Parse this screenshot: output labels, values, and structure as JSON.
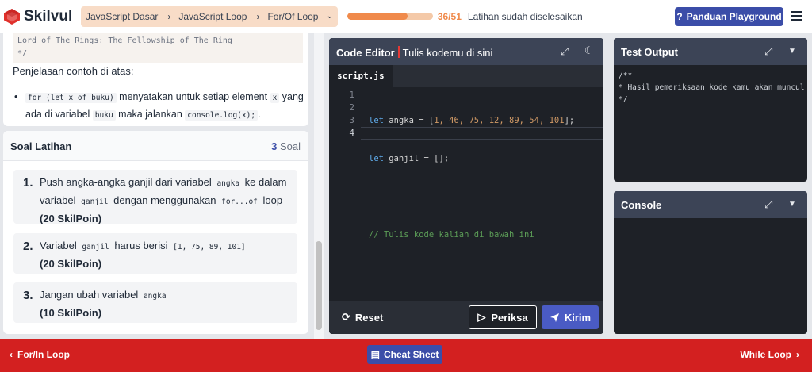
{
  "brand": {
    "name": "Skilvul",
    "color": "#e0302b"
  },
  "breadcrumb": {
    "items": [
      "JavaScript Dasar",
      "JavaScript Loop",
      "For/Of Loop"
    ]
  },
  "progress": {
    "fraction": 0.706,
    "count": "36/51",
    "label": "Latihan sudah diselesaikan",
    "color": "#f08a4b"
  },
  "header": {
    "guide_button": "Panduan Playground"
  },
  "lesson": {
    "code_line1": "Lord of The Rings: The Fellowship of The Ring",
    "code_line2": "*/",
    "explain_heading": "Penjelasan contoh di atas:",
    "bullet": {
      "code_for": "for (let x of buku)",
      "t1": "menyatakan untuk setiap element",
      "code_x": "x",
      "t2": "yang ada di variabel",
      "code_buku": "buku",
      "t3": "maka jalankan",
      "code_log": "console.log(x);",
      "t4": "."
    }
  },
  "exercises": {
    "title": "Soal Latihan",
    "count_number": "3",
    "count_label": "Soal",
    "items": [
      {
        "num": "1.",
        "t1": "Push angka-angka ganjil dari variabel",
        "c1": "angka",
        "t2": "ke dalam variabel",
        "c2": "ganjil",
        "t3": "dengan menggunakan",
        "c3": "for...of",
        "t4": "loop",
        "points": "(20 SkilPoin)"
      },
      {
        "num": "2.",
        "t1": "Variabel",
        "c1": "ganjil",
        "t2": "harus berisi",
        "c2": "[1, 75, 89, 101]",
        "points": "(20 SkilPoin)"
      },
      {
        "num": "3.",
        "t1": "Jangan ubah variabel",
        "c1": "angka",
        "points": "(10 SkilPoin)"
      }
    ]
  },
  "editor": {
    "title": "Code Editor",
    "subtitle": "Tulis kodemu di sini",
    "tab": "script.js",
    "line_numbers": [
      "1",
      "2",
      "3",
      "4"
    ],
    "line1": {
      "kw": "let",
      "text": " angka = [",
      "nums": "1, 46, 75, 12, 89, 54, 101",
      "end": "];"
    },
    "line2": {
      "kw": "let",
      "text": " ganjil = [];"
    },
    "line4": "// Tulis kode kalian di bawah ini",
    "reset_label": "Reset",
    "check_label": "Periksa",
    "submit_label": "Kirim"
  },
  "test_output": {
    "title": "Test Output",
    "body": "/**\n* Hasil pemeriksaan kode kamu akan muncul\n*/"
  },
  "console": {
    "title": "Console"
  },
  "footer": {
    "prev_label": "For/In Loop",
    "cheat_label": "Cheat Sheet",
    "next_label": "While Loop"
  }
}
